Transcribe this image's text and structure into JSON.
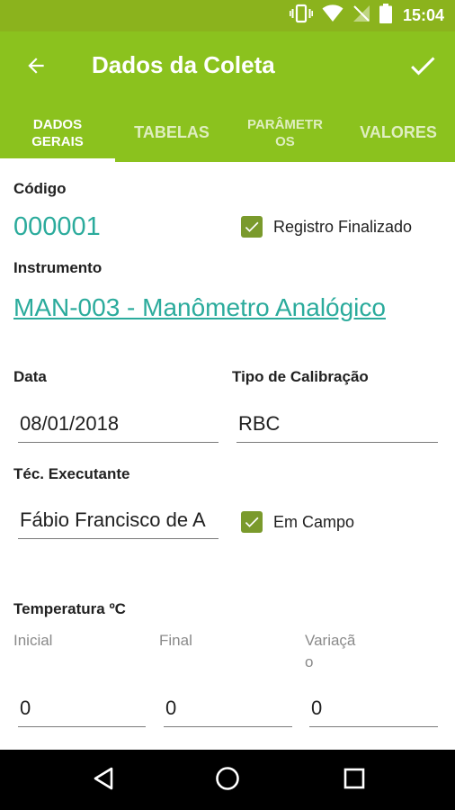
{
  "status_bar": {
    "time": "15:04",
    "icons": [
      "vibrate-icon",
      "wifi-icon",
      "no-signal-icon",
      "battery-icon"
    ]
  },
  "app_bar": {
    "title": "Dados da Coleta",
    "back_icon": "arrow-back-icon",
    "confirm_icon": "check-icon"
  },
  "tabs": [
    {
      "line1": "DADOS",
      "line2": "GERAIS",
      "active": true
    },
    {
      "line1": "TABELAS",
      "line2": "",
      "active": false
    },
    {
      "line1": "PARÂMETR",
      "line2": "OS",
      "active": false
    },
    {
      "line1": "VALORES",
      "line2": "",
      "active": false
    }
  ],
  "form": {
    "codigo_label": "Código",
    "codigo_value": "000001",
    "registro_finalizado_label": "Registro Finalizado",
    "registro_finalizado_checked": true,
    "instrumento_label": "Instrumento",
    "instrumento_value": "MAN-003 - Manômetro Analógico",
    "data_label": "Data",
    "data_value": "08/01/2018",
    "tipo_calibracao_label": "Tipo de Calibração",
    "tipo_calibracao_value": "RBC",
    "tec_executante_label": "Téc. Executante",
    "tec_executante_value": "Fábio Francisco de A",
    "em_campo_label": "Em Campo",
    "em_campo_checked": true,
    "temperatura_label": "Temperatura ºC",
    "inicial_label": "Inicial",
    "final_label": "Final",
    "variacao_label_line1": "Variaçã",
    "variacao_label_line2": "o",
    "inicial_value": "0",
    "final_value": "0",
    "variacao_value": "0"
  },
  "colors": {
    "primary": "#8bc21e",
    "status_bar": "#8bb31d",
    "accent_text": "#2bab9c",
    "checkbox": "#7a9a2c"
  }
}
